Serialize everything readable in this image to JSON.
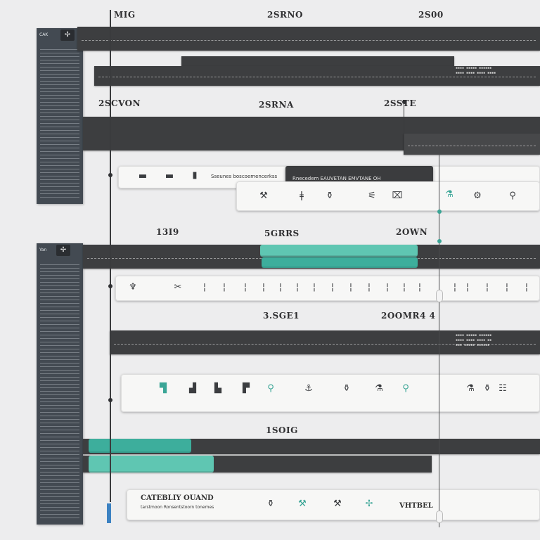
{
  "ruler": {
    "top": [
      "MIG",
      "2SRNO",
      "2S00"
    ],
    "row2": [
      "2SCVON",
      "2SRNA",
      "2SSTE"
    ],
    "row3": [
      "13I9",
      "5GRRS",
      "2OWN"
    ],
    "row4": [
      "3.SGE1",
      "2OOMR4 4"
    ],
    "row5": [
      "1SOIG"
    ]
  },
  "panels": {
    "top_head": "CAK",
    "bottom_head": "Yan"
  },
  "tooltip": {
    "left_text": "Sseunes boscoemencerkss",
    "text": "Rnecedem EAUVETAN EMVTANE OH"
  },
  "footer": {
    "title": "CATEBLIY OUAND",
    "sub": "tarstmoon Ronsentstoorn tonemes",
    "right_label": "VHTBEL"
  },
  "colors": {
    "track": "#3d3e40",
    "teal": "#5fc6b2",
    "panel": "#434a52",
    "marker": "#3c82c2"
  },
  "icons": {
    "strip1": [
      "slider-icon",
      "slider-icon",
      "cursor-icon"
    ],
    "strip2": [
      "wrench-icon",
      "pliers-icon",
      "bottle-icon",
      "cable-icon",
      "tape-icon",
      "saw-icon",
      "drill-icon",
      "clamp-icon"
    ],
    "strip3": [
      "spray-icon",
      "scissors-icon",
      "pin-icon",
      "pin-icon",
      "pin-icon",
      "pin-icon",
      "pin-icon",
      "pin-icon",
      "pin-icon",
      "pin-icon",
      "pin-icon",
      "pin-icon",
      "pin-icon",
      "pin-icon",
      "pin-icon",
      "pin-icon",
      "pin-icon",
      "pin-icon",
      "pin-icon",
      "pin-icon"
    ],
    "strip4": [
      "chair-icon",
      "chair-icon",
      "chair-icon",
      "chair-icon",
      "lamp-icon",
      "faucet-icon",
      "bottle-icon",
      "beaker-icon",
      "jar-icon",
      "beaker-icon",
      "flask-icon",
      "rack-icon"
    ],
    "strip5": [
      "paint-icon",
      "roller-icon",
      "hammer-icon",
      "pen-icon"
    ]
  }
}
